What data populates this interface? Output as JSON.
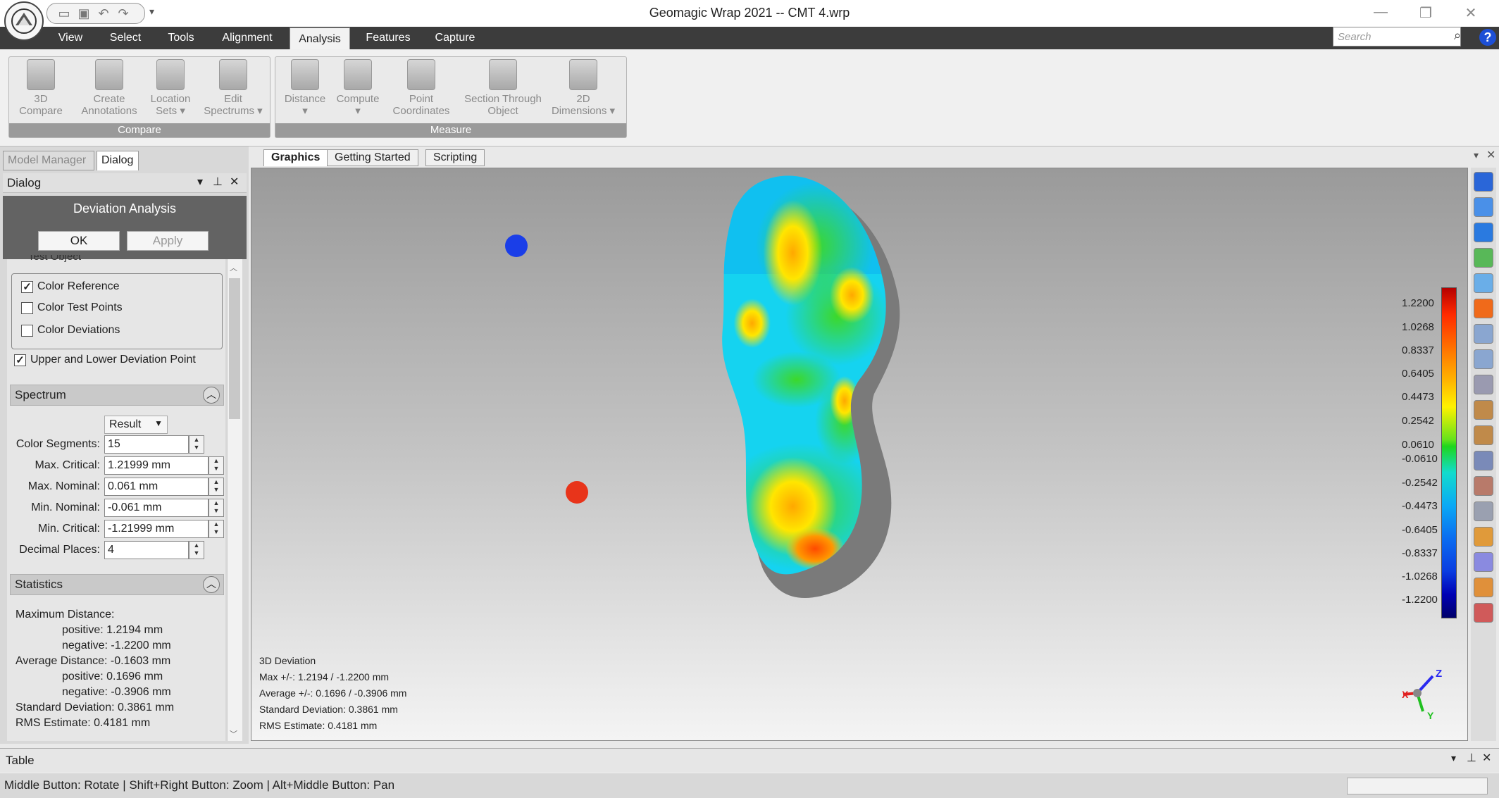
{
  "window": {
    "title": "Geomagic Wrap 2021 -- CMT 4.wrp",
    "minimize": "—",
    "restore": "❐",
    "close": "✕"
  },
  "menu": [
    "View",
    "Select",
    "Tools",
    "Alignment",
    "Analysis",
    "Features",
    "Capture"
  ],
  "search": {
    "placeholder": "Search"
  },
  "ribbon": {
    "compare": {
      "label": "Compare",
      "buttons": [
        {
          "line1": "3D",
          "line2": "Compare"
        },
        {
          "line1": "Create",
          "line2": "Annotations"
        },
        {
          "line1": "Location",
          "line2": "Sets ▾"
        },
        {
          "line1": "Edit",
          "line2": "Spectrums ▾"
        }
      ]
    },
    "measure": {
      "label": "Measure",
      "buttons": [
        {
          "line1": "Distance",
          "line2": "▾"
        },
        {
          "line1": "Compute",
          "line2": "▾"
        },
        {
          "line1": "Point",
          "line2": "Coordinates"
        },
        {
          "line1": "Section Through",
          "line2": "Object"
        },
        {
          "line1": "2D",
          "line2": "Dimensions ▾"
        }
      ]
    }
  },
  "panel_tabs": [
    "Model Manager",
    "Dialog"
  ],
  "dialog": {
    "header": "Dialog",
    "title": "Deviation Analysis",
    "ok": "OK",
    "apply": "Apply",
    "cut_option": "Test Object",
    "options": [
      {
        "label": "Color Reference",
        "checked": true
      },
      {
        "label": "Color Test Points",
        "checked": false
      },
      {
        "label": "Color Deviations",
        "checked": false
      }
    ],
    "upper_lower": {
      "label": "Upper and Lower Deviation Point",
      "checked": true
    },
    "spectrum": {
      "title": "Spectrum",
      "mode": "Result",
      "fields": [
        {
          "label": "Color Segments:",
          "value": "15"
        },
        {
          "label": "Max. Critical:",
          "value": "1.21999 mm"
        },
        {
          "label": "Max. Nominal:",
          "value": "0.061 mm"
        },
        {
          "label": "Min. Nominal:",
          "value": "-0.061 mm"
        },
        {
          "label": "Min. Critical:",
          "value": "-1.21999 mm"
        },
        {
          "label": "Decimal Places:",
          "value": "4"
        }
      ]
    },
    "statistics": {
      "title": "Statistics",
      "lines": [
        "Maximum Distance:",
        "positive: 1.2194 mm",
        "negative: -1.2200 mm",
        "Average Distance: -0.1603 mm",
        "positive: 0.1696 mm",
        "negative: -0.3906 mm",
        "Standard Deviation: 0.3861 mm",
        "RMS Estimate: 0.4181 mm"
      ]
    }
  },
  "graphics_tabs": [
    "Graphics",
    "Getting Started",
    "Scripting"
  ],
  "legend": [
    "1.2200",
    "1.0268",
    "0.8337",
    "0.6405",
    "0.4473",
    "0.2542",
    "0.0610",
    "-0.0610",
    "-0.2542",
    "-0.4473",
    "-0.6405",
    "-0.8337",
    "-1.0268",
    "-1.2200"
  ],
  "info": [
    "3D Deviation",
    "Max +/-: 1.2194 / -1.2200 mm",
    "Average +/-: 0.1696 / -0.3906 mm",
    "Standard Deviation: 0.3861 mm",
    "RMS Estimate: 0.4181 mm"
  ],
  "axis": {
    "z": "Z",
    "x": "X",
    "y": "Y"
  },
  "table_label": "Table",
  "status": "Middle Button: Rotate | Shift+Right Button: Zoom | Alt+Middle Button: Pan"
}
